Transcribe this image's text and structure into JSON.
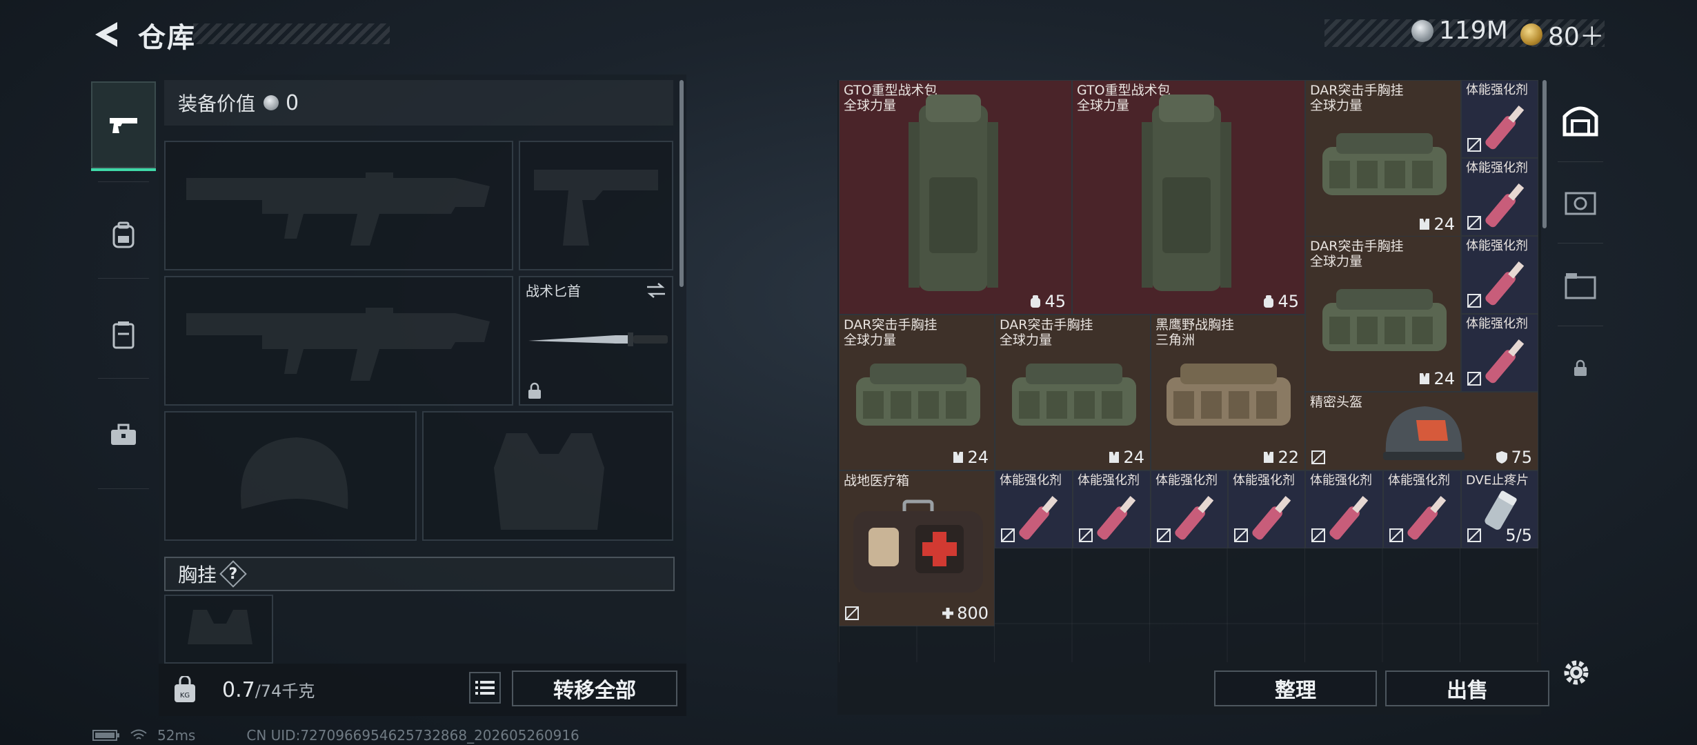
{
  "header": {
    "title": "仓库"
  },
  "currency": {
    "primary": "119M",
    "secondary": "80＋"
  },
  "tabs": [
    {
      "name": "weapons-tab",
      "icon": "pistol-icon",
      "active": true
    },
    {
      "name": "backpack-tab",
      "icon": "backpack-icon",
      "active": false
    },
    {
      "name": "armor-tab",
      "icon": "armor-icon",
      "active": false
    },
    {
      "name": "toolbox-tab",
      "icon": "toolbox-icon",
      "active": false
    }
  ],
  "loadout": {
    "value_label": "装备价值",
    "value": "0",
    "knife_label": "战术匕首",
    "rig_label": "胸挂",
    "rig_help": "?"
  },
  "footer_left": {
    "weight_current": "0.7",
    "weight_max": "/74千克",
    "transfer_all": "转移全部"
  },
  "items": [
    {
      "name": "GTO重型战术包",
      "subtitle": "全球力量",
      "value": "45",
      "icon": "backpack-capacity-icon"
    },
    {
      "name": "GTO重型战术包",
      "subtitle": "全球力量",
      "value": "45",
      "icon": "backpack-capacity-icon"
    },
    {
      "name": "DAR突击手胸挂",
      "subtitle": "全球力量",
      "value": "24",
      "icon": "rig-capacity-icon"
    },
    {
      "name": "DAR突击手胸挂",
      "subtitle": "全球力量",
      "value": "24",
      "icon": "rig-capacity-icon"
    },
    {
      "name": "DAR突击手胸挂",
      "subtitle": "全球力量",
      "value": "24",
      "icon": "rig-capacity-icon"
    },
    {
      "name": "DAR突击手胸挂",
      "subtitle": "全球力量",
      "value": "24",
      "icon": "rig-capacity-icon"
    },
    {
      "name": "黑鹰野战胸挂",
      "subtitle": "三角洲",
      "value": "22",
      "icon": "rig-capacity-icon"
    },
    {
      "name": "精密头盔",
      "subtitle": "",
      "value": "75",
      "icon": "durability-shield-icon"
    },
    {
      "name": "战地医疗箱",
      "subtitle": "",
      "value": "800",
      "icon": "heal-plus-icon"
    },
    {
      "name": "DVE止疼片",
      "subtitle": "",
      "value": "5/5",
      "icon": ""
    },
    {
      "name": "体能强化剂",
      "subtitle": "",
      "value": "",
      "icon": "syringe-icon"
    }
  ],
  "footer_right": {
    "sort": "整理",
    "sell": "出售"
  },
  "status": {
    "ping": "52ms",
    "uid": "CN UID:7270966954625732868_202605260916"
  },
  "colors": {
    "accent": "#3fd9a8",
    "red_item": "#4a2429",
    "brown_item": "#3e3129",
    "blue_item": "#262b40"
  }
}
